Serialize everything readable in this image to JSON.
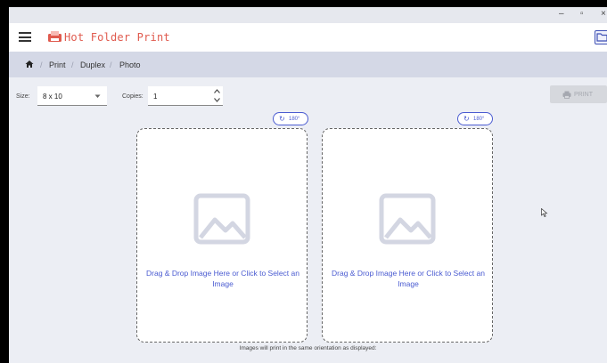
{
  "window": {
    "controls": {
      "minimize": "–",
      "maximize": "▫",
      "close": "×"
    }
  },
  "app": {
    "title": "Hot Folder Print",
    "accent": "#e05a4e",
    "link_color": "#4a5bd1"
  },
  "breadcrumb": {
    "home_icon": "home-icon",
    "separator": "/",
    "items": [
      "Print",
      "Duplex",
      "Photo"
    ]
  },
  "toolbar": {
    "size_label": "Size:",
    "size_value": "8 x 10",
    "copies_label": "Copies:",
    "copies_value": "1",
    "print_label": "PRINT"
  },
  "panels": [
    {
      "rotate_label": "180°",
      "drop_text": "Drag & Drop Image Here or Click to Select an Image"
    },
    {
      "rotate_label": "180°",
      "drop_text": "Drag & Drop Image Here or Click to Select an Image"
    }
  ],
  "footer_note": "Images will print in the same orientation as displayed:"
}
